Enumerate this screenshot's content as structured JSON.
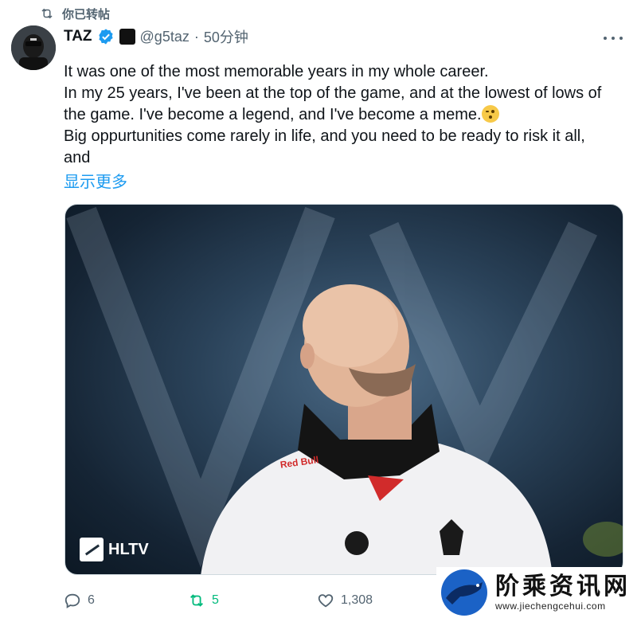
{
  "retweet_banner": {
    "label": "你已转帖",
    "icon": "retweet-icon"
  },
  "author": {
    "name": "TAZ",
    "handle": "@g5taz",
    "separator": "·",
    "time": "50分钟",
    "verified_icon": "verified-badge-icon",
    "affiliate_icon": "g2-affiliate-badge-icon"
  },
  "tweet": {
    "lines": [
      "It was one of the most memorable years in my whole career.",
      "In my 25 years, I've been at the top of the game, and at the lowest of lows of",
      "the game. I've become a legend, and I've become a meme.",
      "Big oppurtunities come rarely in life, and you need to be ready to risk it all,",
      "and"
    ],
    "show_more": "显示更多"
  },
  "media": {
    "watermark_label": "HLTV",
    "jersey_sponsor": "Red Bull"
  },
  "actions": {
    "reply_count": "6",
    "retweet_count": "5",
    "like_count": "1,308"
  },
  "site_watermark": {
    "title": "阶乘资讯网",
    "url": "www.jiechengcehui.com"
  },
  "colors": {
    "accent": "#1d9bf0",
    "retweeted": "#00ba7c",
    "secondary_text": "#536471",
    "primary_text": "#0f1419"
  }
}
